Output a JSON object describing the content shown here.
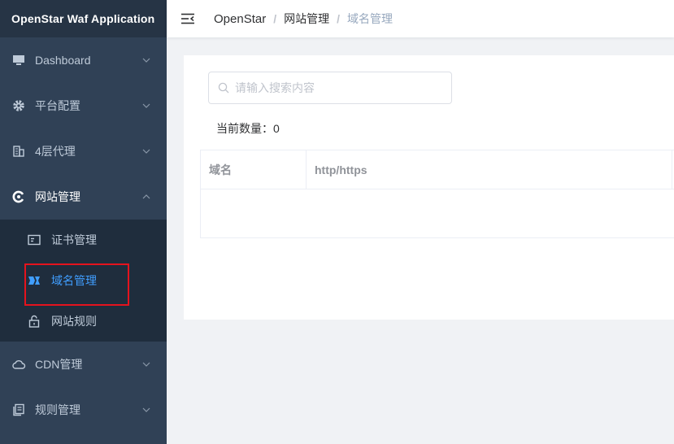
{
  "app": {
    "title": "OpenStar Waf Application"
  },
  "sidebar": {
    "items": [
      {
        "label": "Dashboard",
        "icon": "monitor-icon"
      },
      {
        "label": "平台配置",
        "icon": "gear-icon"
      },
      {
        "label": "4层代理",
        "icon": "building-icon"
      },
      {
        "label": "网站管理",
        "icon": "globe-icon",
        "open": true,
        "children": [
          {
            "label": "证书管理",
            "icon": "certificate-icon"
          },
          {
            "label": "域名管理",
            "icon": "domain-icon",
            "active": true
          },
          {
            "label": "网站规则",
            "icon": "lock-open-icon"
          }
        ]
      },
      {
        "label": "CDN管理",
        "icon": "cloud-icon"
      },
      {
        "label": "规则管理",
        "icon": "document-icon"
      }
    ]
  },
  "header": {
    "breadcrumb": [
      "OpenStar",
      "网站管理",
      "域名管理"
    ]
  },
  "main": {
    "search": {
      "placeholder": "请输入搜索内容",
      "value": ""
    },
    "count_label": "当前数量：0",
    "table": {
      "columns": [
        "域名",
        "http/https"
      ],
      "rows": []
    }
  },
  "colors": {
    "sidebar_bg": "#304156",
    "submenu_bg": "#1f2d3d",
    "active": "#409eff",
    "highlight": "#e5131d"
  }
}
